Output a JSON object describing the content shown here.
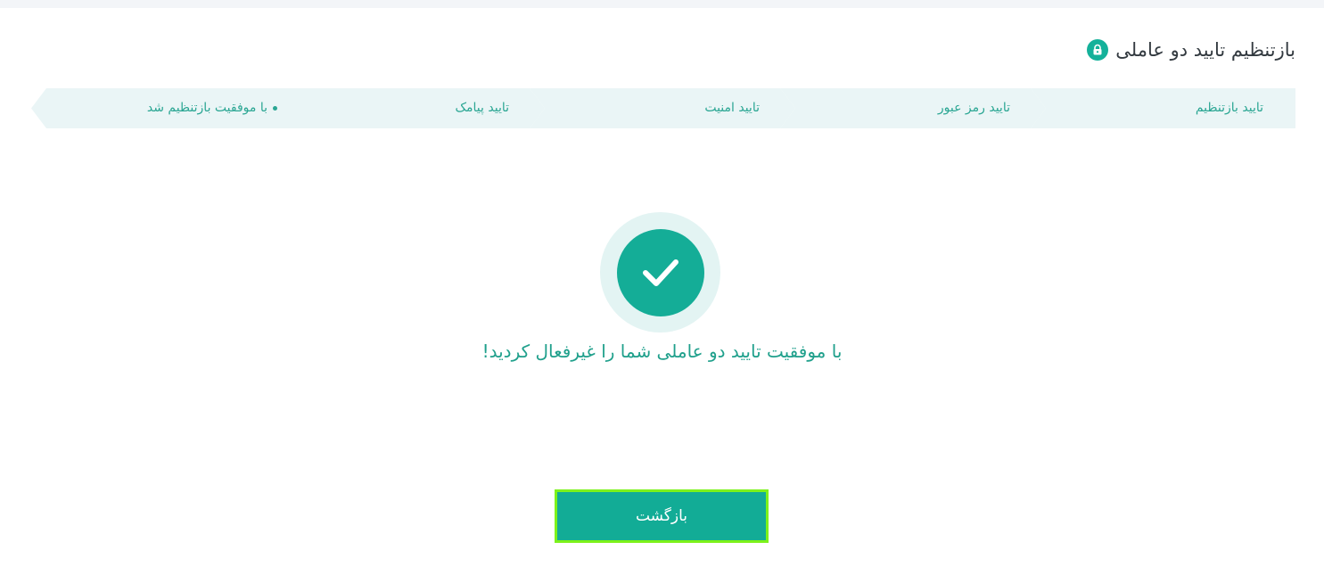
{
  "page": {
    "title": "بازتنظیم تایید دو عاملی",
    "icon": "lock-icon"
  },
  "stepper": {
    "steps": [
      {
        "label": "تایید بازتنظیم",
        "active": false
      },
      {
        "label": "تایید رمز عبور",
        "active": false
      },
      {
        "label": "تایید امنیت",
        "active": false
      },
      {
        "label": "تایید پیامک",
        "active": false
      },
      {
        "label": "با موفقیت بازتنظیم شد",
        "active": true
      }
    ]
  },
  "result": {
    "icon": "check-icon",
    "message": "با موفقیت تایید دو عاملی شما را غیرفعال کردید!"
  },
  "actions": {
    "back_label": "بازگشت"
  },
  "colors": {
    "accent": "#14ad97",
    "step_bg": "#eaf5f6",
    "step_text": "#2aa693",
    "focus_outline": "#7cf21b"
  }
}
